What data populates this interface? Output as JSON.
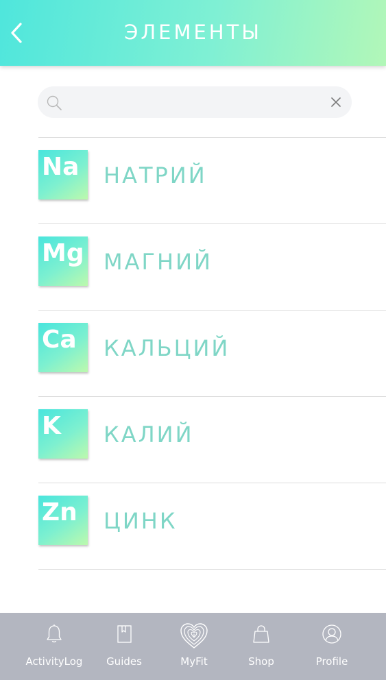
{
  "header": {
    "title": "ЭЛЕМЕНТЫ",
    "back_icon": "chevron-left-icon"
  },
  "search": {
    "value": "",
    "placeholder": "",
    "search_icon": "search-icon",
    "clear_icon": "close-icon"
  },
  "elements": [
    {
      "symbol": "Na",
      "name": "НАТРИЙ"
    },
    {
      "symbol": "Mg",
      "name": "МАГНИЙ"
    },
    {
      "symbol": "Ca",
      "name": "КАЛЬЦИЙ"
    },
    {
      "symbol": "K",
      "name": "КАЛИЙ"
    },
    {
      "symbol": "Zn",
      "name": "ЦИНК"
    }
  ],
  "nav": {
    "items": [
      {
        "label": "ActivityLog",
        "icon": "bell-icon"
      },
      {
        "label": "Guides",
        "icon": "book-icon"
      },
      {
        "label": "MyFit",
        "icon": "fingerprint-heart-icon"
      },
      {
        "label": "Shop",
        "icon": "shopping-bag-icon"
      },
      {
        "label": "Profile",
        "icon": "user-circle-icon"
      }
    ]
  },
  "colors": {
    "header_gradient_start": "#4fe6dc",
    "header_gradient_end": "#b2f7b8",
    "element_name": "#7fd6c6",
    "nav_background": "#b3b6c0",
    "search_background": "#f3f4f6"
  }
}
